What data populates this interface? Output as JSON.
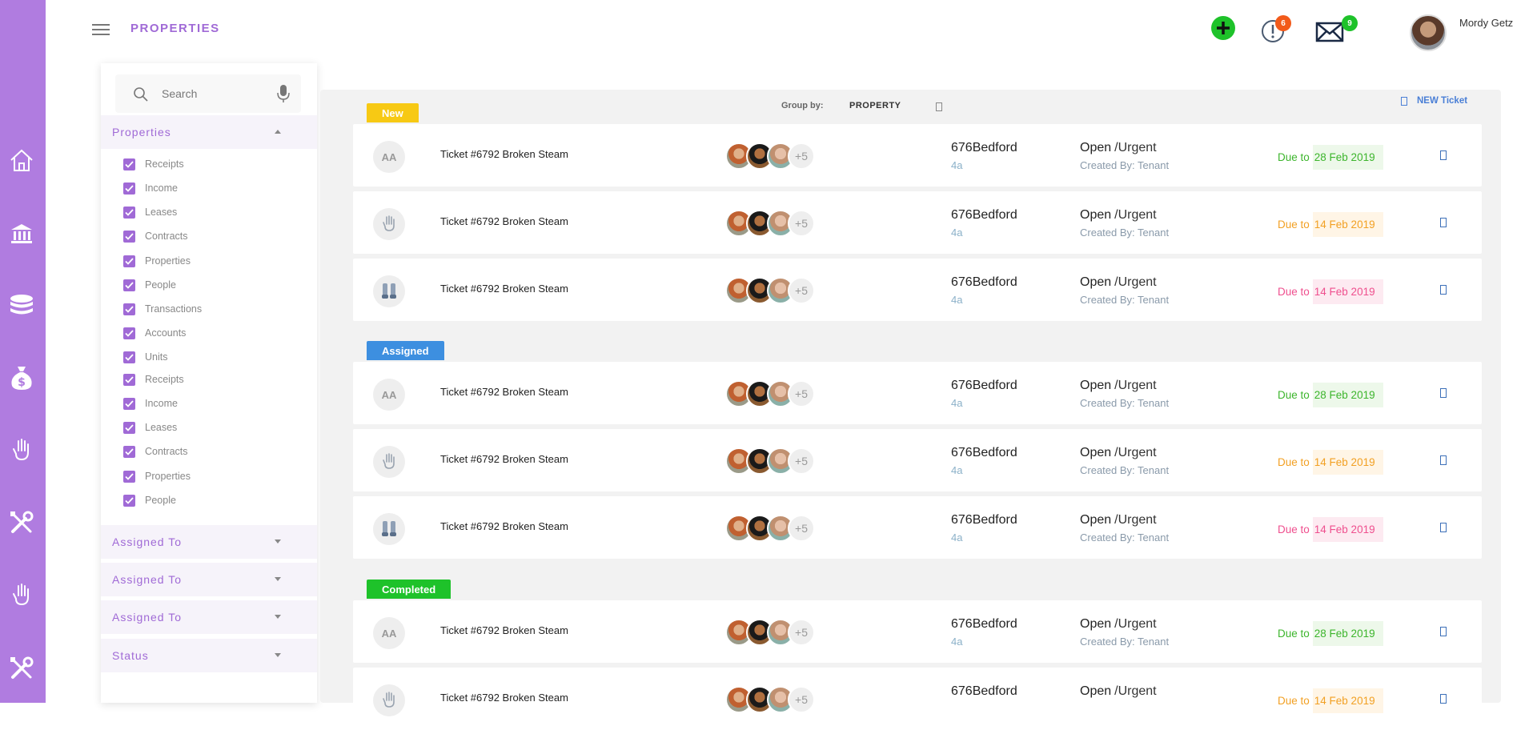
{
  "header": {
    "page_title": "PROPERTIES",
    "alerts_count": "6",
    "messages_count": "9",
    "user_name": "Mordy Getz",
    "colors": {
      "accent": "#a06ad6",
      "rail": "#b07ce0",
      "add": "#1ec22a",
      "alert_badge": "#f25a1a",
      "msg_badge": "#1ec22a"
    }
  },
  "rail": {
    "icons": [
      "home-icon",
      "bank-icon",
      "coins-icon",
      "money-bag-icon",
      "hand-wrench-icon",
      "tools-icon",
      "hand-wrench-icon",
      "tools-icon"
    ]
  },
  "filter": {
    "search_placeholder": "Search",
    "properties_label": "Properties",
    "checkbox_items": [
      "Receipts",
      "Income",
      "Leases",
      "Contracts",
      "Properties",
      "People",
      "Transactions",
      "Accounts",
      "Units",
      "Receipts",
      "Income",
      "Leases",
      "Contracts",
      "Properties",
      "People"
    ],
    "sections": [
      "Assigned To",
      "Assigned To",
      "Assigned To",
      "Status"
    ]
  },
  "board": {
    "group_by_label": "Group by:",
    "group_by_value": "PROPERTY",
    "new_ticket_label": "NEW Ticket",
    "groups": [
      {
        "tag": "New",
        "color": "#f7c914"
      },
      {
        "tag": "Assigned",
        "color": "#3d8fe0"
      },
      {
        "tag": "Completed",
        "color": "#1ec22a"
      }
    ],
    "tickets": [
      {
        "icon": "AA",
        "title": "Ticket #6792 Broken Steam",
        "more": "+5",
        "address": "676Bedford",
        "unit": "4a",
        "status": "Open",
        "priority": "/Urgent",
        "created": "Created By: Tenant",
        "due_prefix": "Due to",
        "due_date": "28 Feb 2019",
        "due_color": "green"
      },
      {
        "icon": "hand-icon",
        "title": "Ticket #6792 Broken Steam",
        "more": "+5",
        "address": "676Bedford",
        "unit": "4a",
        "status": "Open",
        "priority": "/Urgent",
        "created": "Created By: Tenant",
        "due_prefix": "Due to",
        "due_date": "14 Feb 2019",
        "due_color": "orange"
      },
      {
        "icon": "pipes-icon",
        "title": "Ticket #6792 Broken Steam",
        "more": "+5",
        "address": "676Bedford",
        "unit": "4a",
        "status": "Open",
        "priority": "/Urgent",
        "created": "Created By: Tenant",
        "due_prefix": "Due to",
        "due_date": "14 Feb 2019",
        "due_color": "pink"
      },
      {
        "icon": "AA",
        "title": "Ticket #6792 Broken Steam",
        "more": "+5",
        "address": "676Bedford",
        "unit": "4a",
        "status": "Open",
        "priority": "/Urgent",
        "created": "Created By: Tenant",
        "due_prefix": "Due to",
        "due_date": "28 Feb 2019",
        "due_color": "green"
      },
      {
        "icon": "hand-icon",
        "title": "Ticket #6792 Broken Steam",
        "more": "+5",
        "address": "676Bedford",
        "unit": "4a",
        "status": "Open",
        "priority": "/Urgent",
        "created": "Created By: Tenant",
        "due_prefix": "Due to",
        "due_date": "14 Feb 2019",
        "due_color": "orange"
      },
      {
        "icon": "pipes-icon",
        "title": "Ticket #6792 Broken Steam",
        "more": "+5",
        "address": "676Bedford",
        "unit": "4a",
        "status": "Open",
        "priority": "/Urgent",
        "created": "Created By: Tenant",
        "due_prefix": "Due to",
        "due_date": "14 Feb 2019",
        "due_color": "pink"
      },
      {
        "icon": "AA",
        "title": "Ticket #6792 Broken Steam",
        "more": "+5",
        "address": "676Bedford",
        "unit": "4a",
        "status": "Open",
        "priority": "/Urgent",
        "created": "Created By: Tenant",
        "due_prefix": "Due to",
        "due_date": "28 Feb 2019",
        "due_color": "green"
      },
      {
        "icon": "hand-icon",
        "title": "Ticket #6792 Broken Steam",
        "more": "+5",
        "address": "676Bedford",
        "unit": "",
        "status": "Open",
        "priority": "/Urgent",
        "created": "",
        "due_prefix": "Due to",
        "due_date": "14 Feb 2019",
        "due_color": "orange"
      }
    ]
  }
}
